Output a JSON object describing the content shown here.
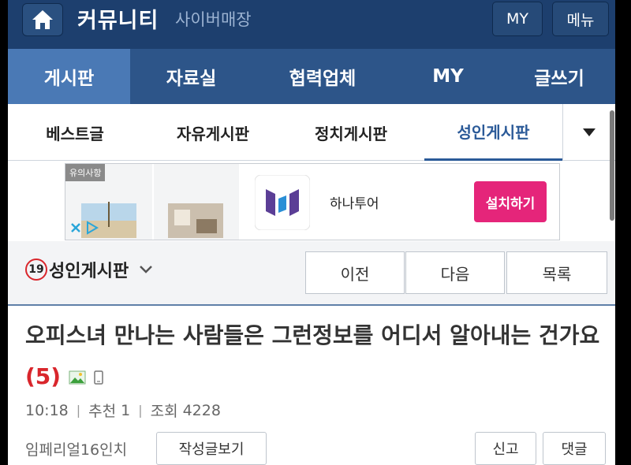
{
  "header": {
    "site_title": "커뮤니티",
    "site_subtitle": "사이버매장",
    "my_button": "MY",
    "menu_button": "메뉴",
    "home_icon": "home-icon"
  },
  "main_nav": {
    "items": [
      {
        "label": "게시판",
        "active": true
      },
      {
        "label": "자료실",
        "active": false
      },
      {
        "label": "협력업체",
        "active": false
      },
      {
        "label": "MY",
        "active": false
      },
      {
        "label": "글쓰기",
        "active": false
      }
    ]
  },
  "sub_nav": {
    "items": [
      {
        "label": "베스트글",
        "active": false
      },
      {
        "label": "자유게시판",
        "active": false
      },
      {
        "label": "정치게시판",
        "active": false
      },
      {
        "label": "성인게시판",
        "active": true
      }
    ],
    "more_icon": "triangle-down-icon"
  },
  "ad": {
    "notice": "유의사항",
    "brand_name": "하나투어",
    "install_button": "설치하기",
    "brand_color": "#5b3e96",
    "install_color": "#e5257a"
  },
  "board": {
    "age_badge": "19",
    "name": "성인게시판",
    "prev_button": "이전",
    "next_button": "다음",
    "list_button": "목록"
  },
  "post": {
    "title": "오피스녀 만나는 사람들은 그런정보를 어디서 알아내는 건가요",
    "comment_count": "(5)",
    "time": "10:18",
    "recommend_label": "추천",
    "recommend_count": "1",
    "views_label": "조회",
    "views_count": "4228",
    "author": "임페리얼16인치",
    "view_posts_button": "작성글보기",
    "report_button": "신고",
    "comment_button": "댓글"
  },
  "colors": {
    "header_bg": "#1d3f6e",
    "nav_bg": "#2d5589",
    "nav_active_bg": "#4a79b5",
    "accent": "#2b5a98",
    "alert_red": "#d9262c"
  }
}
